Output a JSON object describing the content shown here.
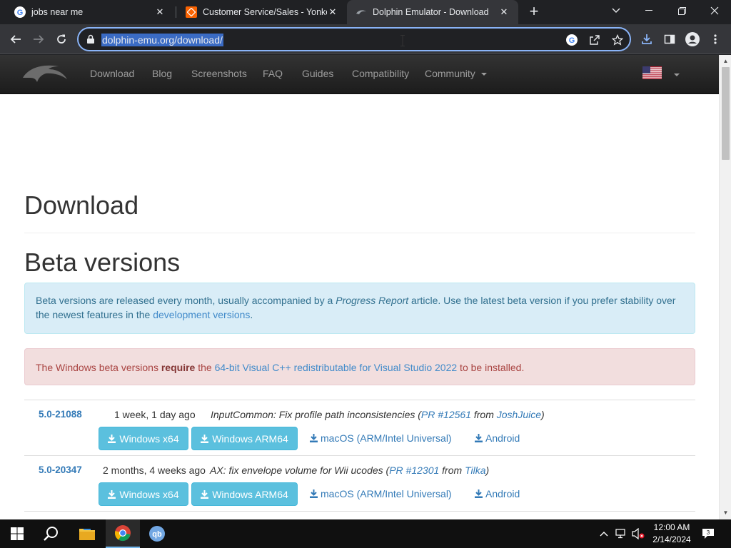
{
  "browser": {
    "tabs": [
      {
        "title": "jobs near me",
        "favicon": "google-icon"
      },
      {
        "title": "Customer Service/Sales - Yonkers",
        "favicon": "homedepot-icon"
      },
      {
        "title": "Dolphin Emulator - Download",
        "favicon": "dolphin-icon"
      }
    ],
    "url": "dolphin-emu.org/download/"
  },
  "site": {
    "nav": [
      "Download",
      "Blog",
      "Screenshots",
      "FAQ",
      "Guides",
      "Compatibility",
      "Community"
    ],
    "language_flag": "us-flag-icon"
  },
  "page": {
    "title": "Download",
    "beta_heading": "Beta versions",
    "info": {
      "part1": "Beta versions are released every month, usually accompanied by a ",
      "progress_report": "Progress Report",
      "part2": " article. Use the latest beta version if you prefer stability over the newest features in the ",
      "dev_link": "development versions",
      "part3": "."
    },
    "warning": {
      "part1": "The Windows beta versions ",
      "require": "require",
      "part2": " the ",
      "vc_link": "64-bit Visual C++ redistributable for Visual Studio 2022",
      "part3": " to be installed."
    },
    "versions": [
      {
        "version": "5.0-21088",
        "date": "1 week, 1 day ago",
        "desc": "InputCommon: Fix profile path inconsistencies",
        "pr": "PR #12561",
        "from": "from",
        "author": "JoshJuice",
        "open_paren": "(",
        "close_paren": ")"
      },
      {
        "version": "5.0-20347",
        "date": "2 months, 4 weeks ago",
        "desc": "AX: fix envelope volume for Wii ucodes",
        "pr": "PR #12301",
        "from": "from",
        "author": "Tilka",
        "open_paren": "(",
        "close_paren": ")"
      }
    ],
    "buttons": {
      "win_x64": "Windows x64",
      "win_arm64": "Windows ARM64",
      "macos": "macOS (ARM/Intel Universal)",
      "android": "Android"
    }
  },
  "taskbar": {
    "time": "12:00 AM",
    "date": "2/14/2024"
  },
  "colors": {
    "nav_bg": "#222222",
    "link": "#337ab7",
    "info_bg": "#d9edf7",
    "danger_bg": "#f2dede",
    "button": "#5bc0de"
  }
}
